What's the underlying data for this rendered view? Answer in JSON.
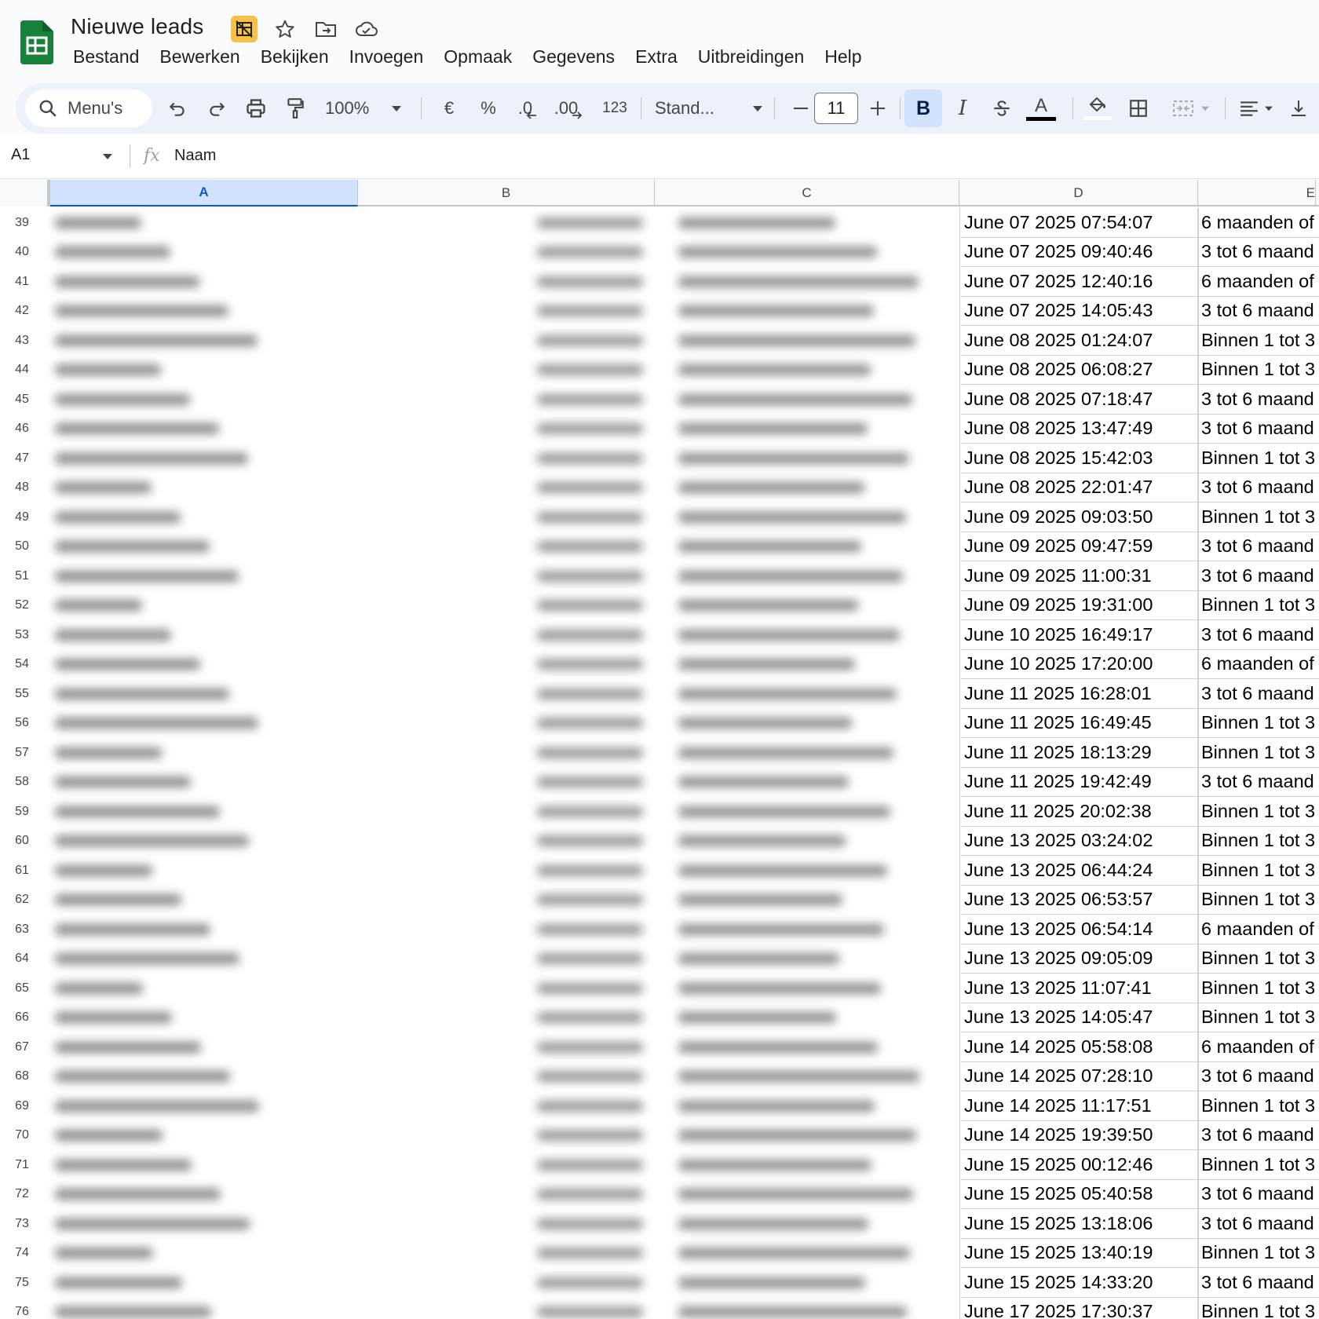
{
  "doc": {
    "title": "Nieuwe leads"
  },
  "menu": [
    "Bestand",
    "Bewerken",
    "Bekijken",
    "Invoegen",
    "Opmaak",
    "Gegevens",
    "Extra",
    "Uitbreidingen",
    "Help"
  ],
  "toolbar": {
    "search_label": "Menu's",
    "zoom": "100%",
    "currency": "€",
    "percent": "%",
    "decimal_decrease": ".0",
    "decimal_increase": ".00",
    "number_format": "123",
    "font": "Stand...",
    "font_size": "11",
    "bold": "B",
    "italic": "I",
    "text_color_letter": "A"
  },
  "formula_bar": {
    "cell_ref": "A1",
    "value": "Naam"
  },
  "columns": [
    "A",
    "B",
    "C",
    "D",
    "E"
  ],
  "rows": [
    {
      "n": "39",
      "d": "June 07 2025 07:54:07",
      "e": "6 maanden of"
    },
    {
      "n": "40",
      "d": "June 07 2025 09:40:46",
      "e": "3 tot 6 maand"
    },
    {
      "n": "41",
      "d": "June 07 2025 12:40:16",
      "e": "6 maanden of"
    },
    {
      "n": "42",
      "d": "June 07 2025 14:05:43",
      "e": "3 tot 6 maand"
    },
    {
      "n": "43",
      "d": "June 08 2025 01:24:07",
      "e": "Binnen 1 tot 3"
    },
    {
      "n": "44",
      "d": "June 08 2025 06:08:27",
      "e": "Binnen 1 tot 3"
    },
    {
      "n": "45",
      "d": "June 08 2025 07:18:47",
      "e": "3 tot 6 maand"
    },
    {
      "n": "46",
      "d": "June 08 2025 13:47:49",
      "e": "3 tot 6 maand"
    },
    {
      "n": "47",
      "d": "June 08 2025 15:42:03",
      "e": "Binnen 1 tot 3"
    },
    {
      "n": "48",
      "d": "June 08 2025 22:01:47",
      "e": "3 tot 6 maand"
    },
    {
      "n": "49",
      "d": "June 09 2025 09:03:50",
      "e": "Binnen 1 tot 3"
    },
    {
      "n": "50",
      "d": "June 09 2025 09:47:59",
      "e": "3 tot 6 maand"
    },
    {
      "n": "51",
      "d": "June 09 2025 11:00:31",
      "e": "3 tot 6 maand"
    },
    {
      "n": "52",
      "d": "June 09 2025 19:31:00",
      "e": "Binnen 1 tot 3"
    },
    {
      "n": "53",
      "d": "June 10 2025 16:49:17",
      "e": "3 tot 6 maand"
    },
    {
      "n": "54",
      "d": "June 10 2025 17:20:00",
      "e": "6 maanden of"
    },
    {
      "n": "55",
      "d": "June 11 2025 16:28:01",
      "e": "3 tot 6 maand"
    },
    {
      "n": "56",
      "d": "June 11 2025 16:49:45",
      "e": "Binnen 1 tot 3"
    },
    {
      "n": "57",
      "d": "June 11 2025 18:13:29",
      "e": "Binnen 1 tot 3"
    },
    {
      "n": "58",
      "d": "June 11 2025 19:42:49",
      "e": "3 tot 6 maand"
    },
    {
      "n": "59",
      "d": "June 11 2025 20:02:38",
      "e": "Binnen 1 tot 3"
    },
    {
      "n": "60",
      "d": "June 13 2025 03:24:02",
      "e": "Binnen 1 tot 3"
    },
    {
      "n": "61",
      "d": "June 13 2025 06:44:24",
      "e": "Binnen 1 tot 3"
    },
    {
      "n": "62",
      "d": "June 13 2025 06:53:57",
      "e": "Binnen 1 tot 3"
    },
    {
      "n": "63",
      "d": "June 13 2025 06:54:14",
      "e": "6 maanden of"
    },
    {
      "n": "64",
      "d": "June 13 2025 09:05:09",
      "e": "Binnen 1 tot 3"
    },
    {
      "n": "65",
      "d": "June 13 2025 11:07:41",
      "e": "Binnen 1 tot 3"
    },
    {
      "n": "66",
      "d": "June 13 2025 14:05:47",
      "e": "Binnen 1 tot 3"
    },
    {
      "n": "67",
      "d": "June 14 2025 05:58:08",
      "e": "6 maanden of"
    },
    {
      "n": "68",
      "d": "June 14 2025 07:28:10",
      "e": "3 tot 6 maand"
    },
    {
      "n": "69",
      "d": "June 14 2025 11:17:51",
      "e": "Binnen 1 tot 3"
    },
    {
      "n": "70",
      "d": "June 14 2025 19:39:50",
      "e": "3 tot 6 maand"
    },
    {
      "n": "71",
      "d": "June 15 2025 00:12:46",
      "e": "Binnen 1 tot 3"
    },
    {
      "n": "72",
      "d": "June 15 2025 05:40:58",
      "e": "3 tot 6 maand"
    },
    {
      "n": "73",
      "d": "June 15 2025 13:18:06",
      "e": "3 tot 6 maand"
    },
    {
      "n": "74",
      "d": "June 15 2025 13:40:19",
      "e": "Binnen 1 tot 3"
    },
    {
      "n": "75",
      "d": "June 15 2025 14:33:20",
      "e": "3 tot 6 maand"
    },
    {
      "n": "76",
      "d": "June 17 2025 17:30:37",
      "e": "Binnen 1 tot 3"
    }
  ],
  "colors": {
    "sheets_green": "#188038",
    "selection_blue": "#d3e3fd",
    "badge_yellow": "#f6c146"
  },
  "icons": [
    "sheets-logo-icon",
    "no-cell-access-icon",
    "star-icon",
    "move-to-folder-icon",
    "cloud-saved-icon",
    "search-icon",
    "undo-icon",
    "redo-icon",
    "print-icon",
    "paint-format-icon",
    "chevron-down-icon",
    "minus-icon",
    "plus-icon",
    "strikethrough-icon",
    "fill-color-icon",
    "borders-icon",
    "merge-cells-icon",
    "align-left-icon",
    "vertical-align-icon",
    "fx-icon"
  ]
}
